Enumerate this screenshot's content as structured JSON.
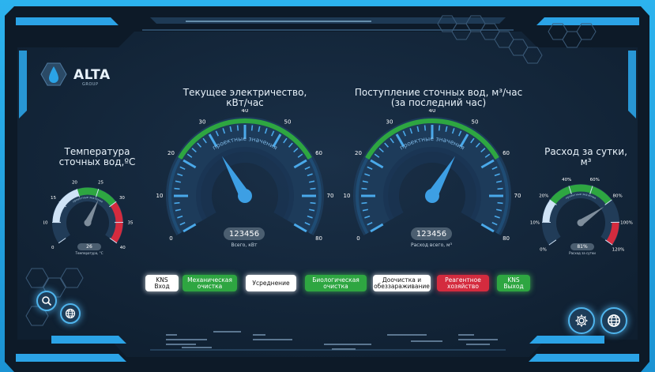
{
  "logo": {
    "name": "ALTA",
    "sub": "GROUP"
  },
  "gauges": {
    "temperature": {
      "title_line1": "Температура",
      "title_line2": "сточных вод,ºС",
      "value_text": "26",
      "caption": "Температура, °С",
      "ticks": [
        "0",
        "10",
        "15",
        "20",
        "25",
        "30",
        "35",
        "40"
      ],
      "arc_text": "проектные значения",
      "min": 0,
      "max": 40,
      "value": 26,
      "zones": [
        {
          "from": 10,
          "to": 20,
          "color": "#cfe3f6"
        },
        {
          "from": 20,
          "to": 30,
          "color": "#2ea641"
        },
        {
          "from": 30,
          "to": 40,
          "color": "#d42b3e"
        }
      ]
    },
    "electricity": {
      "title_line1": "Текущее электричество,",
      "title_line2": "кВт/час",
      "value_text": "123456",
      "caption": "Всего, кВт",
      "ticks": [
        "0",
        "10",
        "20",
        "30",
        "40",
        "50",
        "60",
        "70",
        "80"
      ],
      "arc_text": "проектные значения",
      "min": 0,
      "max": 80,
      "value": 30,
      "zone": {
        "from": 20,
        "to": 60,
        "color": "#2ea641"
      }
    },
    "wastewater": {
      "title_line1": "Поступление сточных вод, м³/час",
      "title_line2": "(за последний час)",
      "value_text": "123456",
      "caption": "Расход всего, м³",
      "ticks": [
        "0",
        "10",
        "20",
        "30",
        "40",
        "50",
        "60",
        "70",
        "80"
      ],
      "arc_text": "проектные значения",
      "min": 0,
      "max": 80,
      "value": 50,
      "zone": {
        "from": 20,
        "to": 60,
        "color": "#2ea641"
      }
    },
    "daily_flow": {
      "title_line1": "Расход за сутки,",
      "title_line2": "м³",
      "value_text": "81%",
      "caption": "Расход за сутки",
      "ticks": [
        "0%",
        "10%",
        "20%",
        "40%",
        "60%",
        "80%",
        "100%",
        "120%"
      ],
      "arc_text": "проектные значения",
      "min": 0,
      "max": 120,
      "value": 81,
      "zones": [
        {
          "from": 10,
          "to": 20,
          "color": "#cfe3f6"
        },
        {
          "from": 20,
          "to": 80,
          "color": "#2ea641"
        },
        {
          "from": 100,
          "to": 120,
          "color": "#d42b3e"
        }
      ]
    }
  },
  "process": [
    {
      "label": "KNS\nВход",
      "state": "white"
    },
    {
      "label": "Механическая\nочистка",
      "state": "green"
    },
    {
      "label": "Усреднение",
      "state": "white"
    },
    {
      "label": "Биологическая\nочистка",
      "state": "green"
    },
    {
      "label": "Доочистка и\nобеззараживание",
      "state": "white"
    },
    {
      "label": "Реагентное\nхозяйство",
      "state": "red"
    },
    {
      "label": "KNS\nВыход",
      "state": "green"
    }
  ],
  "buttons": {
    "search": "search-icon",
    "globe_left": "globe-icon",
    "settings": "gear-icon",
    "globe_right": "globe-icon"
  },
  "colors": {
    "panel": "#13263a",
    "accent": "#2ba3e6",
    "green": "#2ea641",
    "red": "#d42b3e",
    "white_zone": "#cfe3f6"
  }
}
